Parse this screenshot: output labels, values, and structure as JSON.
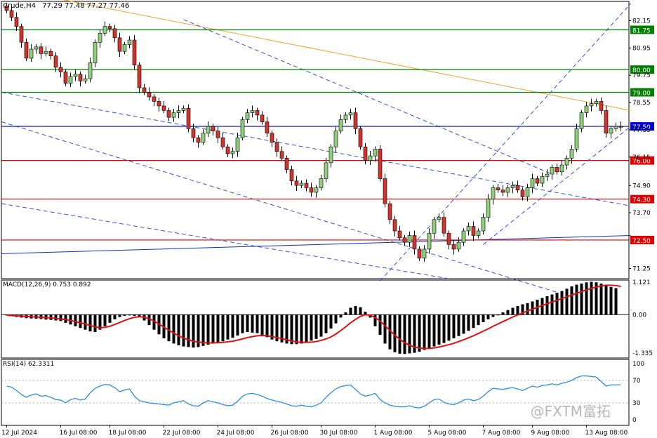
{
  "header": {
    "symbol": "Crude,H4",
    "ohlc": "77.29 77.48 77.27 77.46"
  },
  "watermark": "@FXTM富拓",
  "chart_data": [
    {
      "type": "candlestick",
      "name": "price",
      "ylim": [
        70.8,
        83.0
      ],
      "y_ticks": [
        "82.15",
        "80.95",
        "79.75",
        "78.55",
        "77.35",
        "76.15",
        "74.90",
        "73.70",
        "72.50",
        "71.25"
      ],
      "x_ticks": [
        "12 Jul 2024",
        "16 Jul 08:00",
        "18 Jul 08:00",
        "22 Jul 08:00",
        "24 Jul 08:00",
        "26 Jul 08:00",
        "30 Jul 08:00",
        "1 Aug 08:00",
        "5 Aug 08:00",
        "7 Aug 08:00",
        "9 Aug 08:00",
        "13 Aug 08:00"
      ],
      "levels": [
        {
          "value": 81.75,
          "label": "81.75",
          "color": "#008000"
        },
        {
          "value": 80.0,
          "label": "80.00",
          "color": "#008000"
        },
        {
          "value": 79.0,
          "label": "79.00",
          "color": "#008000"
        },
        {
          "value": 77.5,
          "label": "77.50",
          "color": "#0000cc"
        },
        {
          "value": 76.0,
          "label": "76.00",
          "color": "#e00000"
        },
        {
          "value": 74.3,
          "label": "74.30",
          "color": "#e00000"
        },
        {
          "value": 72.5,
          "label": "72.50",
          "color": "#e00000"
        }
      ],
      "current_price": 77.46,
      "closes": [
        82.6,
        82.3,
        81.9,
        81.2,
        80.5,
        80.9,
        81.0,
        80.7,
        80.8,
        80.6,
        80.1,
        79.9,
        79.4,
        79.7,
        79.8,
        79.5,
        79.6,
        80.3,
        81.2,
        81.6,
        81.9,
        81.8,
        81.4,
        80.8,
        81.1,
        81.3,
        80.2,
        79.2,
        79.0,
        78.8,
        78.6,
        78.4,
        78.2,
        77.9,
        78.1,
        78.2,
        78.3,
        77.4,
        77.0,
        76.8,
        77.2,
        77.5,
        77.3,
        77.0,
        76.6,
        76.3,
        76.4,
        77.0,
        77.8,
        78.1,
        78.2,
        78.0,
        77.7,
        77.2,
        76.8,
        76.4,
        76.1,
        75.6,
        75.1,
        74.9,
        75.0,
        74.8,
        74.6,
        74.8,
        75.2,
        75.9,
        76.6,
        77.3,
        77.8,
        78.0,
        78.1,
        77.4,
        76.6,
        76.0,
        76.2,
        76.5,
        75.2,
        74.1,
        73.4,
        72.9,
        72.6,
        72.4,
        72.7,
        72.1,
        71.7,
        72.1,
        72.8,
        73.4,
        73.5,
        72.8,
        72.3,
        72.1,
        72.4,
        72.9,
        73.1,
        72.7,
        72.9,
        73.5,
        74.3,
        74.8,
        74.7,
        74.6,
        74.8,
        74.9,
        74.7,
        74.4,
        74.8,
        75.2,
        75.0,
        75.3,
        75.4,
        75.7,
        75.5,
        75.8,
        76.1,
        76.5,
        77.4,
        78.1,
        78.4,
        78.5,
        78.6,
        78.2,
        77.2,
        77.4,
        77.5,
        77.46
      ]
    },
    {
      "type": "histogram",
      "name": "MACD(12,26,9)",
      "label": "MACD(12,26,9) 0.753 0.892",
      "ylim": [
        -1.5,
        1.2
      ],
      "y_ticks": [
        "1.121",
        "0.00",
        "-1.335"
      ],
      "values": [
        -0.02,
        -0.05,
        -0.08,
        -0.1,
        -0.12,
        -0.13,
        -0.14,
        -0.15,
        -0.17,
        -0.18,
        -0.2,
        -0.22,
        -0.28,
        -0.34,
        -0.4,
        -0.46,
        -0.52,
        -0.58,
        -0.6,
        -0.52,
        -0.4,
        -0.28,
        -0.16,
        -0.08,
        -0.04,
        -0.02,
        -0.04,
        -0.08,
        -0.2,
        -0.36,
        -0.52,
        -0.68,
        -0.82,
        -0.92,
        -1.0,
        -1.06,
        -1.1,
        -1.12,
        -1.14,
        -1.12,
        -1.08,
        -1.04,
        -1.0,
        -0.96,
        -0.92,
        -0.86,
        -0.8,
        -0.72,
        -0.64,
        -0.6,
        -0.62,
        -0.64,
        -0.7,
        -0.78,
        -0.86,
        -0.92,
        -0.96,
        -1.0,
        -1.02,
        -1.02,
        -1.0,
        -0.96,
        -0.9,
        -0.84,
        -0.76,
        -0.64,
        -0.48,
        -0.3,
        -0.1,
        0.08,
        0.24,
        0.3,
        0.26,
        0.1,
        -0.1,
        -0.4,
        -0.7,
        -1.0,
        -1.2,
        -1.3,
        -1.35,
        -1.36,
        -1.34,
        -1.32,
        -1.28,
        -1.22,
        -1.16,
        -1.1,
        -1.04,
        -0.98,
        -0.9,
        -0.82,
        -0.74,
        -0.66,
        -0.56,
        -0.46,
        -0.36,
        -0.26,
        -0.16,
        -0.08,
        0.0,
        0.08,
        0.16,
        0.24,
        0.3,
        0.36,
        0.4,
        0.46,
        0.52,
        0.58,
        0.64,
        0.7,
        0.76,
        0.82,
        0.9,
        0.98,
        1.04,
        1.08,
        1.12,
        1.14,
        1.12,
        1.08,
        1.02,
        0.96,
        0.92
      ],
      "signal": [
        -0.02,
        -0.03,
        -0.04,
        -0.05,
        -0.06,
        -0.07,
        -0.08,
        -0.09,
        -0.1,
        -0.11,
        -0.13,
        -0.15,
        -0.17,
        -0.2,
        -0.24,
        -0.28,
        -0.32,
        -0.37,
        -0.42,
        -0.45,
        -0.44,
        -0.4,
        -0.34,
        -0.27,
        -0.2,
        -0.14,
        -0.09,
        -0.07,
        -0.09,
        -0.14,
        -0.22,
        -0.32,
        -0.43,
        -0.54,
        -0.64,
        -0.73,
        -0.81,
        -0.87,
        -0.92,
        -0.95,
        -0.97,
        -0.98,
        -0.98,
        -0.97,
        -0.96,
        -0.94,
        -0.92,
        -0.88,
        -0.84,
        -0.79,
        -0.76,
        -0.73,
        -0.72,
        -0.73,
        -0.76,
        -0.79,
        -0.83,
        -0.87,
        -0.91,
        -0.94,
        -0.96,
        -0.96,
        -0.95,
        -0.93,
        -0.89,
        -0.84,
        -0.77,
        -0.67,
        -0.55,
        -0.42,
        -0.28,
        -0.16,
        -0.06,
        0.0,
        -0.02,
        -0.1,
        -0.22,
        -0.38,
        -0.55,
        -0.71,
        -0.85,
        -0.97,
        -1.06,
        -1.12,
        -1.16,
        -1.17,
        -1.17,
        -1.15,
        -1.12,
        -1.08,
        -1.04,
        -0.99,
        -0.93,
        -0.87,
        -0.8,
        -0.73,
        -0.65,
        -0.57,
        -0.49,
        -0.4,
        -0.32,
        -0.24,
        -0.16,
        -0.08,
        -0.01,
        0.06,
        0.13,
        0.19,
        0.26,
        0.32,
        0.38,
        0.44,
        0.5,
        0.56,
        0.62,
        0.68,
        0.74,
        0.8,
        0.86,
        0.91,
        0.96,
        1.0,
        1.02,
        1.02,
        1.01,
        0.98
      ]
    },
    {
      "type": "line",
      "name": "RSI(14)",
      "label": "RSI(14) 62.3311",
      "ylim": [
        0,
        100
      ],
      "y_ticks": [
        "100",
        "70",
        "30",
        "0"
      ],
      "values": [
        60,
        58,
        52,
        45,
        40,
        44,
        46,
        42,
        43,
        40,
        36,
        35,
        30,
        36,
        38,
        35,
        37,
        48,
        56,
        60,
        63,
        62,
        57,
        50,
        53,
        55,
        42,
        34,
        32,
        30,
        29,
        28,
        27,
        26,
        30,
        32,
        34,
        28,
        25,
        24,
        30,
        34,
        32,
        30,
        27,
        25,
        26,
        33,
        42,
        46,
        47,
        45,
        42,
        38,
        35,
        33,
        31,
        28,
        25,
        24,
        26,
        24,
        23,
        26,
        30,
        40,
        48,
        55,
        59,
        61,
        62,
        54,
        46,
        42,
        44,
        47,
        36,
        30,
        26,
        24,
        23,
        23,
        25,
        22,
        21,
        24,
        30,
        36,
        37,
        31,
        28,
        27,
        30,
        35,
        37,
        34,
        36,
        42,
        50,
        56,
        55,
        54,
        56,
        57,
        55,
        52,
        56,
        60,
        58,
        61,
        62,
        64,
        62,
        65,
        67,
        70,
        75,
        78,
        78,
        77,
        76,
        68,
        60,
        62,
        62,
        62.33
      ]
    }
  ]
}
